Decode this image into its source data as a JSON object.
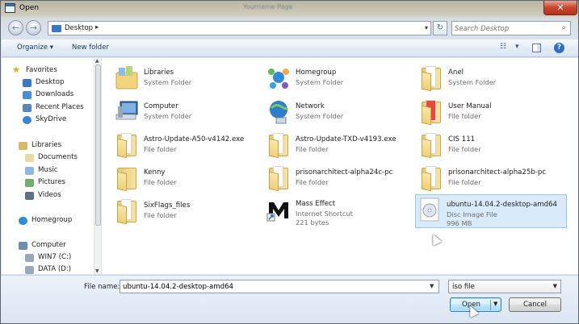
{
  "window": {
    "title": "Open",
    "background_text": "Yourname Page"
  },
  "address": {
    "path": "Desktop",
    "search_placeholder": "Search Desktop"
  },
  "toolbar": {
    "organize": "Organize",
    "new_folder": "New folder"
  },
  "nav": {
    "favorites": "Favorites",
    "favorites_items": [
      "Desktop",
      "Downloads",
      "Recent Places",
      "SkyDrive"
    ],
    "libraries": "Libraries",
    "libraries_items": [
      "Documents",
      "Music",
      "Pictures",
      "Videos"
    ],
    "homegroup": "Homegroup",
    "computer": "Computer",
    "computer_items": [
      "WIN7 (C:)",
      "DATA (D:)"
    ]
  },
  "items": [
    {
      "name": "Libraries",
      "type": "System Folder",
      "icon": "libraries-icon"
    },
    {
      "name": "Homegroup",
      "type": "System Folder",
      "icon": "homegroup-icon"
    },
    {
      "name": "Anel",
      "type": "System Folder",
      "icon": "user-folder-icon"
    },
    {
      "name": "Computer",
      "type": "System Folder",
      "icon": "computer-icon"
    },
    {
      "name": "Network",
      "type": "System Folder",
      "icon": "network-icon"
    },
    {
      "name": "User Manual",
      "type": "File folder",
      "icon": "folder-icon"
    },
    {
      "name": "Astro-Update-A50-v4142.exe",
      "type": "File folder",
      "icon": "folder-icon"
    },
    {
      "name": "Astro-Update-TXD-v4193.exe",
      "type": "File folder",
      "icon": "folder-icon"
    },
    {
      "name": "CIS 111",
      "type": "File folder",
      "icon": "folder-icon"
    },
    {
      "name": "Kenny",
      "type": "File folder",
      "icon": "folder-icon"
    },
    {
      "name": "prisonarchitect-alpha24c-pc",
      "type": "File folder",
      "icon": "folder-icon"
    },
    {
      "name": "prisonarchitect-alpha25b-pc",
      "type": "File folder",
      "icon": "folder-icon"
    },
    {
      "name": "SixFlags_files",
      "type": "File folder",
      "icon": "folder-icon"
    },
    {
      "name": "Mass Effect",
      "type": "Internet Shortcut",
      "size": "221 bytes",
      "icon": "mass-effect-icon"
    },
    {
      "name": "ubuntu-14.04.2-desktop-amd64",
      "type": "Disc Image File",
      "size": "996 MB",
      "icon": "disc-image-icon"
    }
  ],
  "footer": {
    "file_name_label": "File name:",
    "file_name_value": "ubuntu-14.04.2-desktop-amd64",
    "file_type": "iso file",
    "open_label": "Open",
    "cancel_label": "Cancel"
  }
}
